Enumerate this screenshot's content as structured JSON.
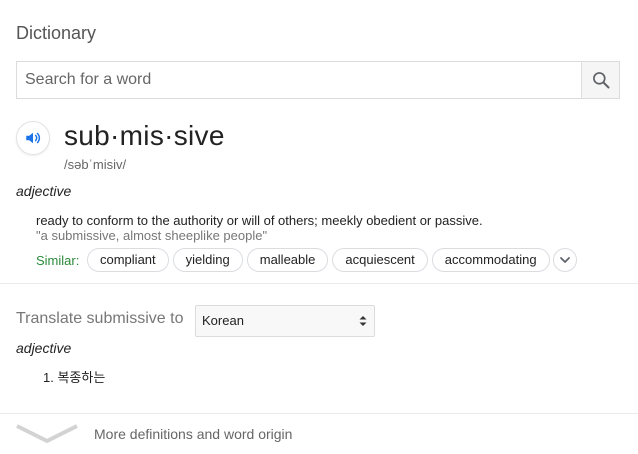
{
  "header": {
    "title": "Dictionary"
  },
  "search": {
    "placeholder": "Search for a word",
    "value": ""
  },
  "entry": {
    "word": "sub·mis·sive",
    "phonetic": "/səbˈmisiv/",
    "part_of_speech": "adjective",
    "definition": "ready to conform to the authority or will of others; meekly obedient or passive.",
    "example": "\"a submissive, almost sheeplike people\"",
    "similar_label": "Similar:",
    "similar": [
      "compliant",
      "yielding",
      "malleable",
      "acquiescent",
      "accommodating"
    ]
  },
  "translate": {
    "label": "Translate submissive to",
    "selected_language": "Korean",
    "part_of_speech": "adjective",
    "items": [
      {
        "num": "1.",
        "text": "복종하는"
      }
    ]
  },
  "footer": {
    "more_label": "More definitions and word origin"
  },
  "colors": {
    "accent": "#1a73e8",
    "similar_label": "#2c8a3c"
  }
}
